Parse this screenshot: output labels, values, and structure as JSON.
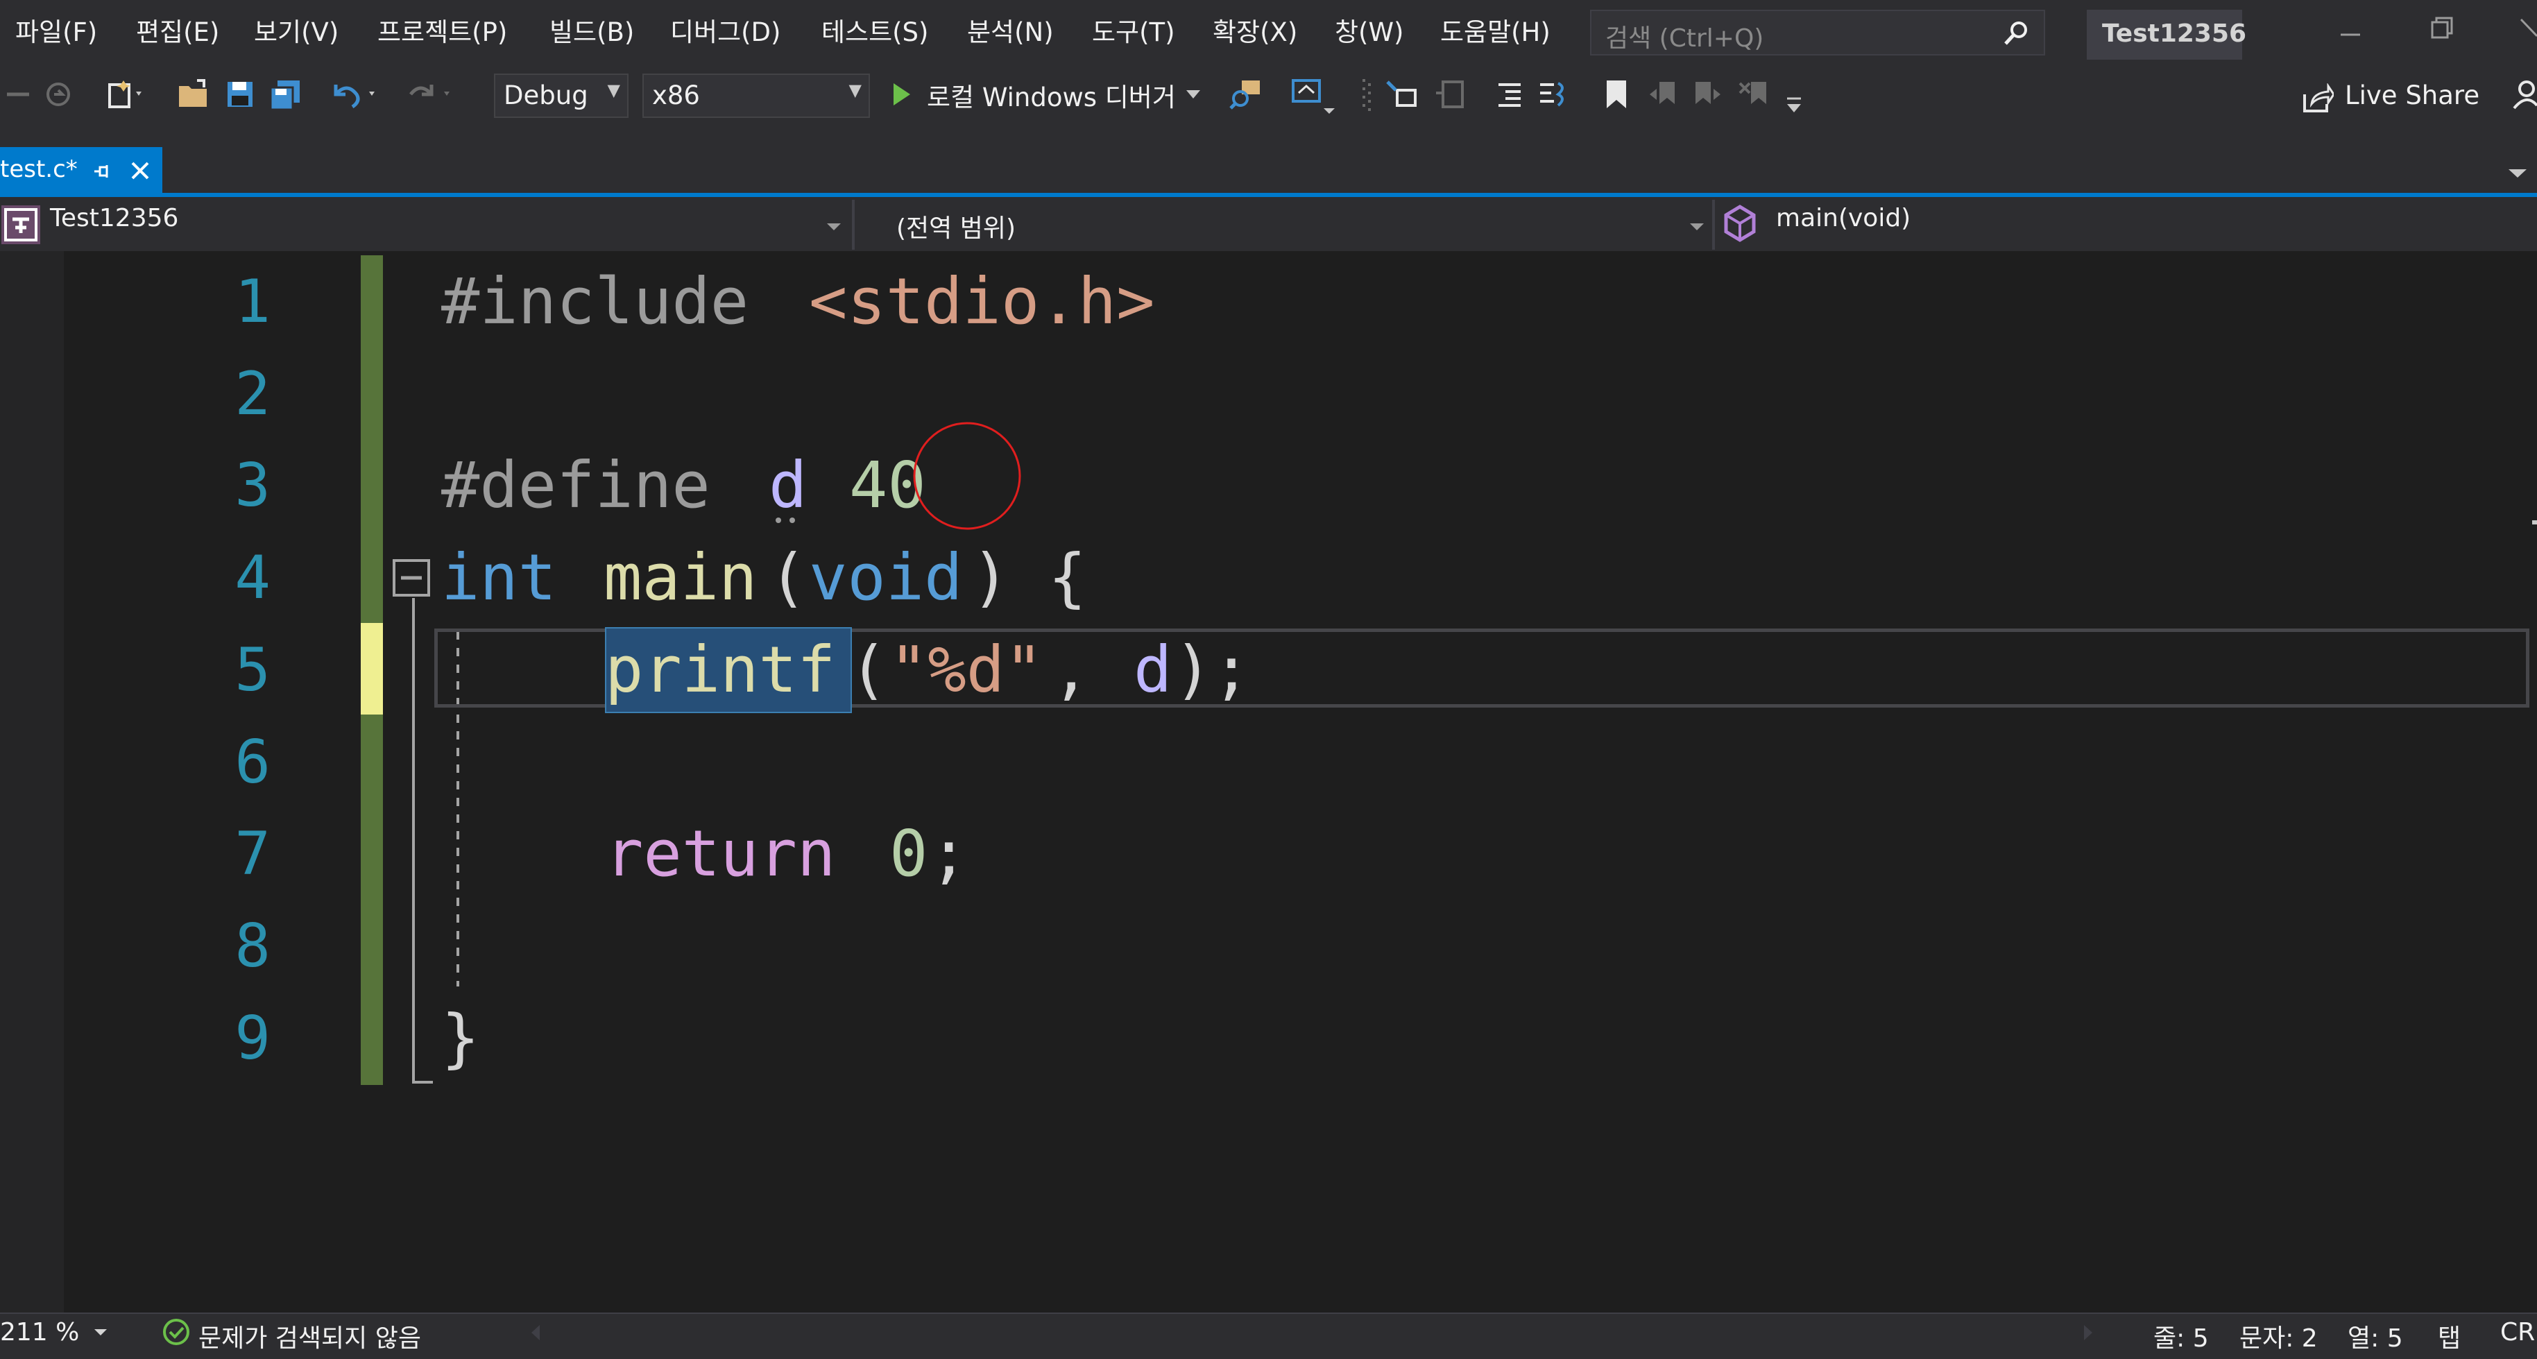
{
  "menu": {
    "items": [
      "파일(F)",
      "편집(E)",
      "보기(V)",
      "프로젝트(P)",
      "빌드(B)",
      "디버그(D)",
      "테스트(S)",
      "분석(N)",
      "도구(T)",
      "확장(X)",
      "창(W)",
      "도움말(H)"
    ],
    "search_placeholder": "검색 (Ctrl+Q)",
    "solution_title": "Test12356"
  },
  "toolbar": {
    "configuration": "Debug",
    "platform": "x86",
    "start_debugger": "로컬 Windows 디버거",
    "live_share": "Live Share"
  },
  "tab": {
    "file_name": "test.c*"
  },
  "navbar": {
    "project": "Test12356",
    "scope": "(전역 범위)",
    "member": "main(void)"
  },
  "editor": {
    "line_numbers": [
      "1",
      "2",
      "3",
      "4",
      "5",
      "6",
      "7",
      "8",
      "9"
    ],
    "code": {
      "l1_directive": "#include",
      "l1_header": "<stdio.h>",
      "l3_directive": "#define",
      "l3_macro": "d",
      "l3_value": "40",
      "l4_type": "int",
      "l4_func": "main",
      "l4_open_paren": "(",
      "l4_param": "void",
      "l4_close": ") {",
      "l5_func": "printf",
      "l5_paren": "(",
      "l5_string": "\"%d\"",
      "l5_comma": ",",
      "l5_arg": "d",
      "l5_close": ");",
      "l7_keyword": "return",
      "l7_value": "0",
      "l7_semicolon": ";",
      "l9_brace": "}"
    }
  },
  "status": {
    "zoom": "211 %",
    "issues": "문제가 검색되지 않음",
    "line": "줄: 5",
    "char": "문자: 2",
    "col": "열: 5",
    "tab": "탭",
    "eol": "CRLF"
  },
  "colors": {
    "accent": "#007acc",
    "keyword": "#569cd6",
    "control_keyword": "#d8a0df",
    "function": "#dcdcaa",
    "string": "#d69d85",
    "number": "#b5cea8",
    "macro": "#beb7ff",
    "preprocessor": "#9b9b9b",
    "line_number": "#2b91af",
    "change_saved": "#57743a",
    "change_unsaved": "#efef91"
  }
}
